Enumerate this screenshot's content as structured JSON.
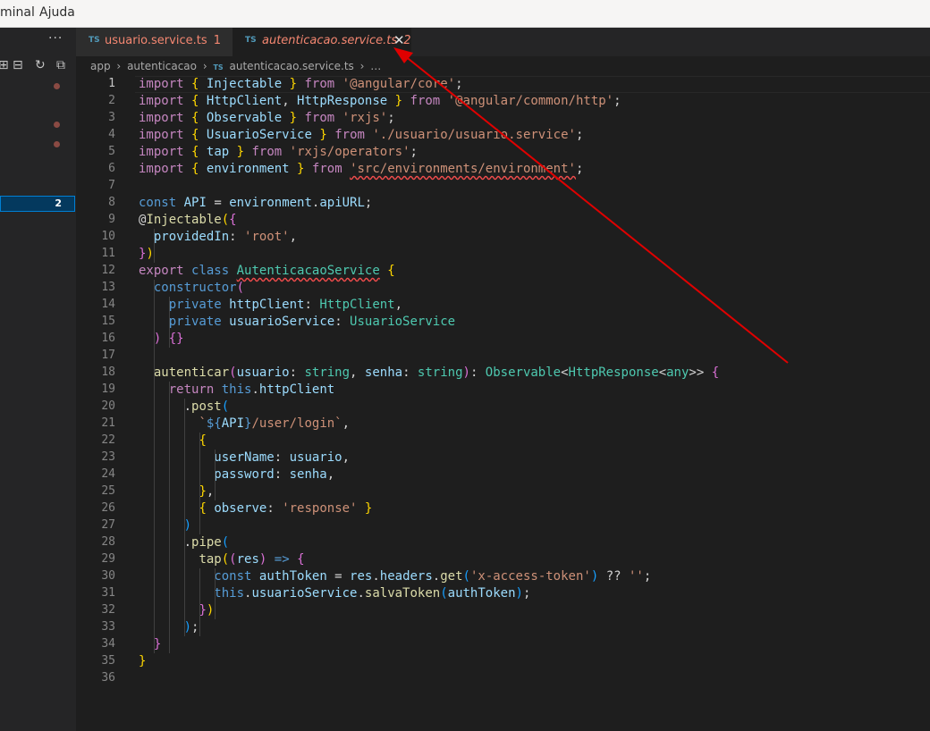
{
  "menu": {
    "items": [
      "minal",
      "Ajuda"
    ]
  },
  "sidebar": {
    "more": "···",
    "badge": "2"
  },
  "tabs": [
    {
      "icon": "TS",
      "title": "usuario.service.ts",
      "badge": "1"
    },
    {
      "icon": "TS",
      "title": "autenticacao.service.ts",
      "badge": "2",
      "close": "✕"
    }
  ],
  "breadcrumb": {
    "parts": [
      "app",
      "autenticacao"
    ],
    "icon": "TS",
    "file": "autenticacao.service.ts",
    "ellipsis": "…",
    "sep": "›"
  },
  "editor": {
    "line_numbers": [
      "1",
      "2",
      "3",
      "4",
      "5",
      "6",
      "7",
      "8",
      "9",
      "10",
      "11",
      "12",
      "13",
      "14",
      "15",
      "16",
      "17",
      "18",
      "19",
      "20",
      "21",
      "22",
      "23",
      "24",
      "25",
      "26",
      "27",
      "28",
      "29",
      "30",
      "31",
      "32",
      "33",
      "34",
      "35",
      "36"
    ],
    "lines": [
      [
        [
          "kw2",
          "import"
        ],
        [
          "pl",
          " "
        ],
        [
          "br1",
          "{"
        ],
        [
          "pl",
          " "
        ],
        [
          "var",
          "Injectable"
        ],
        [
          "pl",
          " "
        ],
        [
          "br1",
          "}"
        ],
        [
          "pl",
          " "
        ],
        [
          "kw2",
          "from"
        ],
        [
          "pl",
          " "
        ],
        [
          "str",
          "'@angular/core'"
        ],
        [
          "pl",
          ";"
        ]
      ],
      [
        [
          "kw2",
          "import"
        ],
        [
          "pl",
          " "
        ],
        [
          "br1",
          "{"
        ],
        [
          "pl",
          " "
        ],
        [
          "var",
          "HttpClient"
        ],
        [
          "pl",
          ", "
        ],
        [
          "var",
          "HttpResponse"
        ],
        [
          "pl",
          " "
        ],
        [
          "br1",
          "}"
        ],
        [
          "pl",
          " "
        ],
        [
          "kw2",
          "from"
        ],
        [
          "pl",
          " "
        ],
        [
          "str",
          "'@angular/common/http'"
        ],
        [
          "pl",
          ";"
        ]
      ],
      [
        [
          "kw2",
          "import"
        ],
        [
          "pl",
          " "
        ],
        [
          "br1",
          "{"
        ],
        [
          "pl",
          " "
        ],
        [
          "var",
          "Observable"
        ],
        [
          "pl",
          " "
        ],
        [
          "br1",
          "}"
        ],
        [
          "pl",
          " "
        ],
        [
          "kw2",
          "from"
        ],
        [
          "pl",
          " "
        ],
        [
          "str",
          "'rxjs'"
        ],
        [
          "pl",
          ";"
        ]
      ],
      [
        [
          "kw2",
          "import"
        ],
        [
          "pl",
          " "
        ],
        [
          "br1",
          "{"
        ],
        [
          "pl",
          " "
        ],
        [
          "var",
          "UsuarioService"
        ],
        [
          "pl",
          " "
        ],
        [
          "br1",
          "}"
        ],
        [
          "pl",
          " "
        ],
        [
          "kw2",
          "from"
        ],
        [
          "pl",
          " "
        ],
        [
          "str",
          "'./usuario/usuario.service'"
        ],
        [
          "pl",
          ";"
        ]
      ],
      [
        [
          "kw2",
          "import"
        ],
        [
          "pl",
          " "
        ],
        [
          "br1",
          "{"
        ],
        [
          "pl",
          " "
        ],
        [
          "var",
          "tap"
        ],
        [
          "pl",
          " "
        ],
        [
          "br1",
          "}"
        ],
        [
          "pl",
          " "
        ],
        [
          "kw2",
          "from"
        ],
        [
          "pl",
          " "
        ],
        [
          "str",
          "'rxjs/operators'"
        ],
        [
          "pl",
          ";"
        ]
      ],
      [
        [
          "kw2",
          "import"
        ],
        [
          "pl",
          " "
        ],
        [
          "br1",
          "{"
        ],
        [
          "pl",
          " "
        ],
        [
          "var",
          "environment"
        ],
        [
          "pl",
          " "
        ],
        [
          "br1",
          "}"
        ],
        [
          "pl",
          " "
        ],
        [
          "kw2",
          "from"
        ],
        [
          "pl",
          " "
        ],
        [
          "str sq",
          "'src/environments/environment'"
        ],
        [
          "pl",
          ";"
        ]
      ],
      [],
      [
        [
          "kw",
          "const"
        ],
        [
          "pl",
          " "
        ],
        [
          "var",
          "API"
        ],
        [
          "pl",
          " = "
        ],
        [
          "var",
          "environment"
        ],
        [
          "pl",
          "."
        ],
        [
          "var",
          "apiURL"
        ],
        [
          "pl",
          ";"
        ]
      ],
      [
        [
          "pl",
          "@"
        ],
        [
          "fn",
          "Injectable"
        ],
        [
          "br1",
          "("
        ],
        [
          "br2",
          "{"
        ]
      ],
      [
        [
          "pl",
          "  "
        ],
        [
          "var",
          "providedIn"
        ],
        [
          "pl",
          ": "
        ],
        [
          "str",
          "'root'"
        ],
        [
          "pl",
          ","
        ]
      ],
      [
        [
          "br2",
          "}"
        ],
        [
          "br1",
          ")"
        ]
      ],
      [
        [
          "kw2",
          "export"
        ],
        [
          "pl",
          " "
        ],
        [
          "kw",
          "class"
        ],
        [
          "pl",
          " "
        ],
        [
          "ty sq",
          "AutenticacaoService"
        ],
        [
          "pl",
          " "
        ],
        [
          "br1",
          "{"
        ]
      ],
      [
        [
          "pl",
          "  "
        ],
        [
          "kw",
          "constructor"
        ],
        [
          "br2",
          "("
        ]
      ],
      [
        [
          "pl",
          "    "
        ],
        [
          "kw",
          "private"
        ],
        [
          "pl",
          " "
        ],
        [
          "var",
          "httpClient"
        ],
        [
          "pl",
          ": "
        ],
        [
          "ty",
          "HttpClient"
        ],
        [
          "pl",
          ","
        ]
      ],
      [
        [
          "pl",
          "    "
        ],
        [
          "kw",
          "private"
        ],
        [
          "pl",
          " "
        ],
        [
          "var",
          "usuarioService"
        ],
        [
          "pl",
          ": "
        ],
        [
          "ty",
          "UsuarioService"
        ]
      ],
      [
        [
          "pl",
          "  "
        ],
        [
          "br2",
          ")"
        ],
        [
          "pl",
          " "
        ],
        [
          "br2",
          "{}"
        ]
      ],
      [],
      [
        [
          "pl",
          "  "
        ],
        [
          "fn",
          "autenticar"
        ],
        [
          "br2",
          "("
        ],
        [
          "var",
          "usuario"
        ],
        [
          "pl",
          ": "
        ],
        [
          "ty",
          "string"
        ],
        [
          "pl",
          ", "
        ],
        [
          "var",
          "senha"
        ],
        [
          "pl",
          ": "
        ],
        [
          "ty",
          "string"
        ],
        [
          "br2",
          ")"
        ],
        [
          "pl",
          ": "
        ],
        [
          "ty",
          "Observable"
        ],
        [
          "pl",
          "<"
        ],
        [
          "ty",
          "HttpResponse"
        ],
        [
          "pl",
          "<"
        ],
        [
          "ty",
          "any"
        ],
        [
          "pl",
          ">> "
        ],
        [
          "br2",
          "{"
        ]
      ],
      [
        [
          "pl",
          "    "
        ],
        [
          "kw2",
          "return"
        ],
        [
          "pl",
          " "
        ],
        [
          "kw",
          "this"
        ],
        [
          "pl",
          "."
        ],
        [
          "var",
          "httpClient"
        ]
      ],
      [
        [
          "pl",
          "      ."
        ],
        [
          "fn",
          "post"
        ],
        [
          "br3",
          "("
        ]
      ],
      [
        [
          "pl",
          "        "
        ],
        [
          "str",
          "`"
        ],
        [
          "kw",
          "${"
        ],
        [
          "var",
          "API"
        ],
        [
          "kw",
          "}"
        ],
        [
          "str",
          "/user/login`"
        ],
        [
          "pl",
          ","
        ]
      ],
      [
        [
          "pl",
          "        "
        ],
        [
          "br1",
          "{"
        ]
      ],
      [
        [
          "pl",
          "          "
        ],
        [
          "var",
          "userName"
        ],
        [
          "pl",
          ": "
        ],
        [
          "var",
          "usuario"
        ],
        [
          "pl",
          ","
        ]
      ],
      [
        [
          "pl",
          "          "
        ],
        [
          "var",
          "password"
        ],
        [
          "pl",
          ": "
        ],
        [
          "var",
          "senha"
        ],
        [
          "pl",
          ","
        ]
      ],
      [
        [
          "pl",
          "        "
        ],
        [
          "br1",
          "}"
        ],
        [
          "pl",
          ","
        ]
      ],
      [
        [
          "pl",
          "        "
        ],
        [
          "br1",
          "{"
        ],
        [
          "pl",
          " "
        ],
        [
          "var",
          "observe"
        ],
        [
          "pl",
          ": "
        ],
        [
          "str",
          "'response'"
        ],
        [
          "pl",
          " "
        ],
        [
          "br1",
          "}"
        ]
      ],
      [
        [
          "pl",
          "      "
        ],
        [
          "br3",
          ")"
        ]
      ],
      [
        [
          "pl",
          "      ."
        ],
        [
          "fn",
          "pipe"
        ],
        [
          "br3",
          "("
        ]
      ],
      [
        [
          "pl",
          "        "
        ],
        [
          "fn",
          "tap"
        ],
        [
          "br1",
          "("
        ],
        [
          "br2",
          "("
        ],
        [
          "var",
          "res"
        ],
        [
          "br2",
          ")"
        ],
        [
          "pl",
          " "
        ],
        [
          "kw",
          "=>"
        ],
        [
          "pl",
          " "
        ],
        [
          "br2",
          "{"
        ]
      ],
      [
        [
          "pl",
          "          "
        ],
        [
          "kw",
          "const"
        ],
        [
          "pl",
          " "
        ],
        [
          "var",
          "authToken"
        ],
        [
          "pl",
          " = "
        ],
        [
          "var",
          "res"
        ],
        [
          "pl",
          "."
        ],
        [
          "var",
          "headers"
        ],
        [
          "pl",
          "."
        ],
        [
          "fn",
          "get"
        ],
        [
          "br3",
          "("
        ],
        [
          "str",
          "'x-access-token'"
        ],
        [
          "br3",
          ")"
        ],
        [
          "pl",
          " ?? "
        ],
        [
          "str",
          "''"
        ],
        [
          "pl",
          ";"
        ]
      ],
      [
        [
          "pl",
          "          "
        ],
        [
          "kw",
          "this"
        ],
        [
          "pl",
          "."
        ],
        [
          "var",
          "usuarioService"
        ],
        [
          "pl",
          "."
        ],
        [
          "fn",
          "salvaToken"
        ],
        [
          "br3",
          "("
        ],
        [
          "var",
          "authToken"
        ],
        [
          "br3",
          ")"
        ],
        [
          "pl",
          ";"
        ]
      ],
      [
        [
          "pl",
          "        "
        ],
        [
          "br2",
          "}"
        ],
        [
          "br1",
          ")"
        ]
      ],
      [
        [
          "pl",
          "      "
        ],
        [
          "br3",
          ")"
        ],
        [
          "pl",
          ";"
        ]
      ],
      [
        [
          "pl",
          "  "
        ],
        [
          "br2",
          "}"
        ]
      ],
      [
        [
          "br1",
          "}"
        ]
      ],
      []
    ]
  },
  "colors": {
    "annotation_arrow": "#e00000",
    "tab_modified": "#f48771",
    "ts_icon": "#519aba"
  }
}
